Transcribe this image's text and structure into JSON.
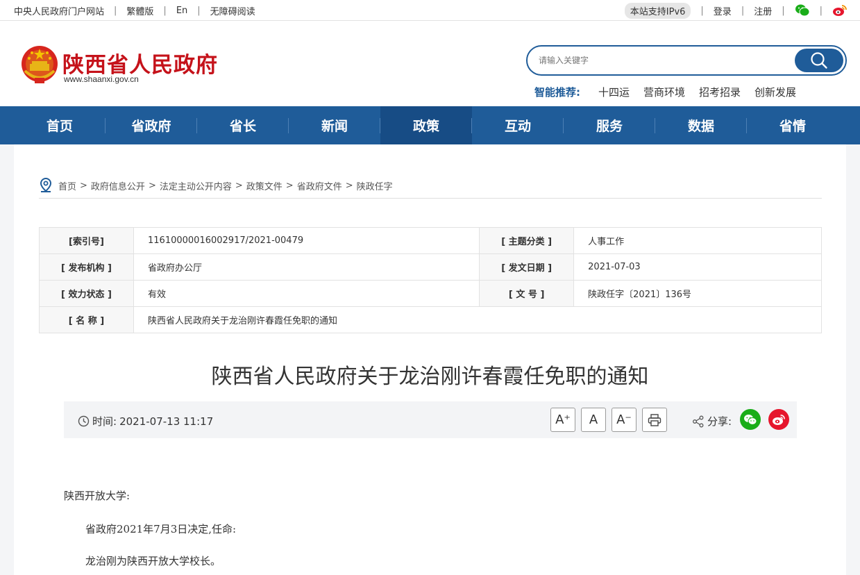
{
  "topbar": {
    "links": [
      "中央人民政府门户网站",
      "繁體版",
      "En",
      "无障碍阅读"
    ],
    "ipv6": "本站支持IPv6",
    "login": "登录",
    "register": "注册"
  },
  "header": {
    "site_title": "陕西省人民政府",
    "site_url": "www.shaanxi.gov.cn",
    "search_placeholder": "请输入关键字",
    "recommend_label": "智能推荐:",
    "recommend_items": [
      "十四运",
      "营商环境",
      "招考招录",
      "创新发展"
    ]
  },
  "nav": {
    "items": [
      "首页",
      "省政府",
      "省长",
      "新闻",
      "政策",
      "互动",
      "服务",
      "数据",
      "省情"
    ],
    "active": "政策"
  },
  "breadcrumb": [
    "首页",
    "政府信息公开",
    "法定主动公开内容",
    "政策文件",
    "省政府文件",
    "陕政任字"
  ],
  "meta": {
    "index_no_label": "[索引号]",
    "index_no": "11610000016002917/2021-00479",
    "topic_label": "[ 主题分类 ]",
    "topic": "人事工作",
    "issuer_label": "[ 发布机构 ]",
    "issuer": "省政府办公厅",
    "date_label": "[ 发文日期 ]",
    "date": "2021-07-03",
    "status_label": "[ 效力状态 ]",
    "status": "有效",
    "docno_label": "[ 文 号 ]",
    "docno": "陕政任字〔2021〕136号",
    "name_label": "[ 名 称 ]",
    "name": "陕西省人民政府关于龙治刚许春霞任免职的通知"
  },
  "article": {
    "title": "陕西省人民政府关于龙治刚许春霞任免职的通知",
    "time_label": "时间:",
    "time": "2021-07-13 11:17",
    "font_large": "A⁺",
    "font_normal": "A",
    "font_small": "A⁻",
    "share_label": "分享:",
    "paragraphs": [
      "陕西开放大学:",
      "省政府2021年7月3日决定,任命:",
      "龙治刚为陕西开放大学校长。"
    ]
  },
  "colors": {
    "brand_blue": "#1f5c99",
    "brand_red": "#c5121a",
    "wechat_green": "#1aad19",
    "weibo_red": "#e6162d"
  }
}
